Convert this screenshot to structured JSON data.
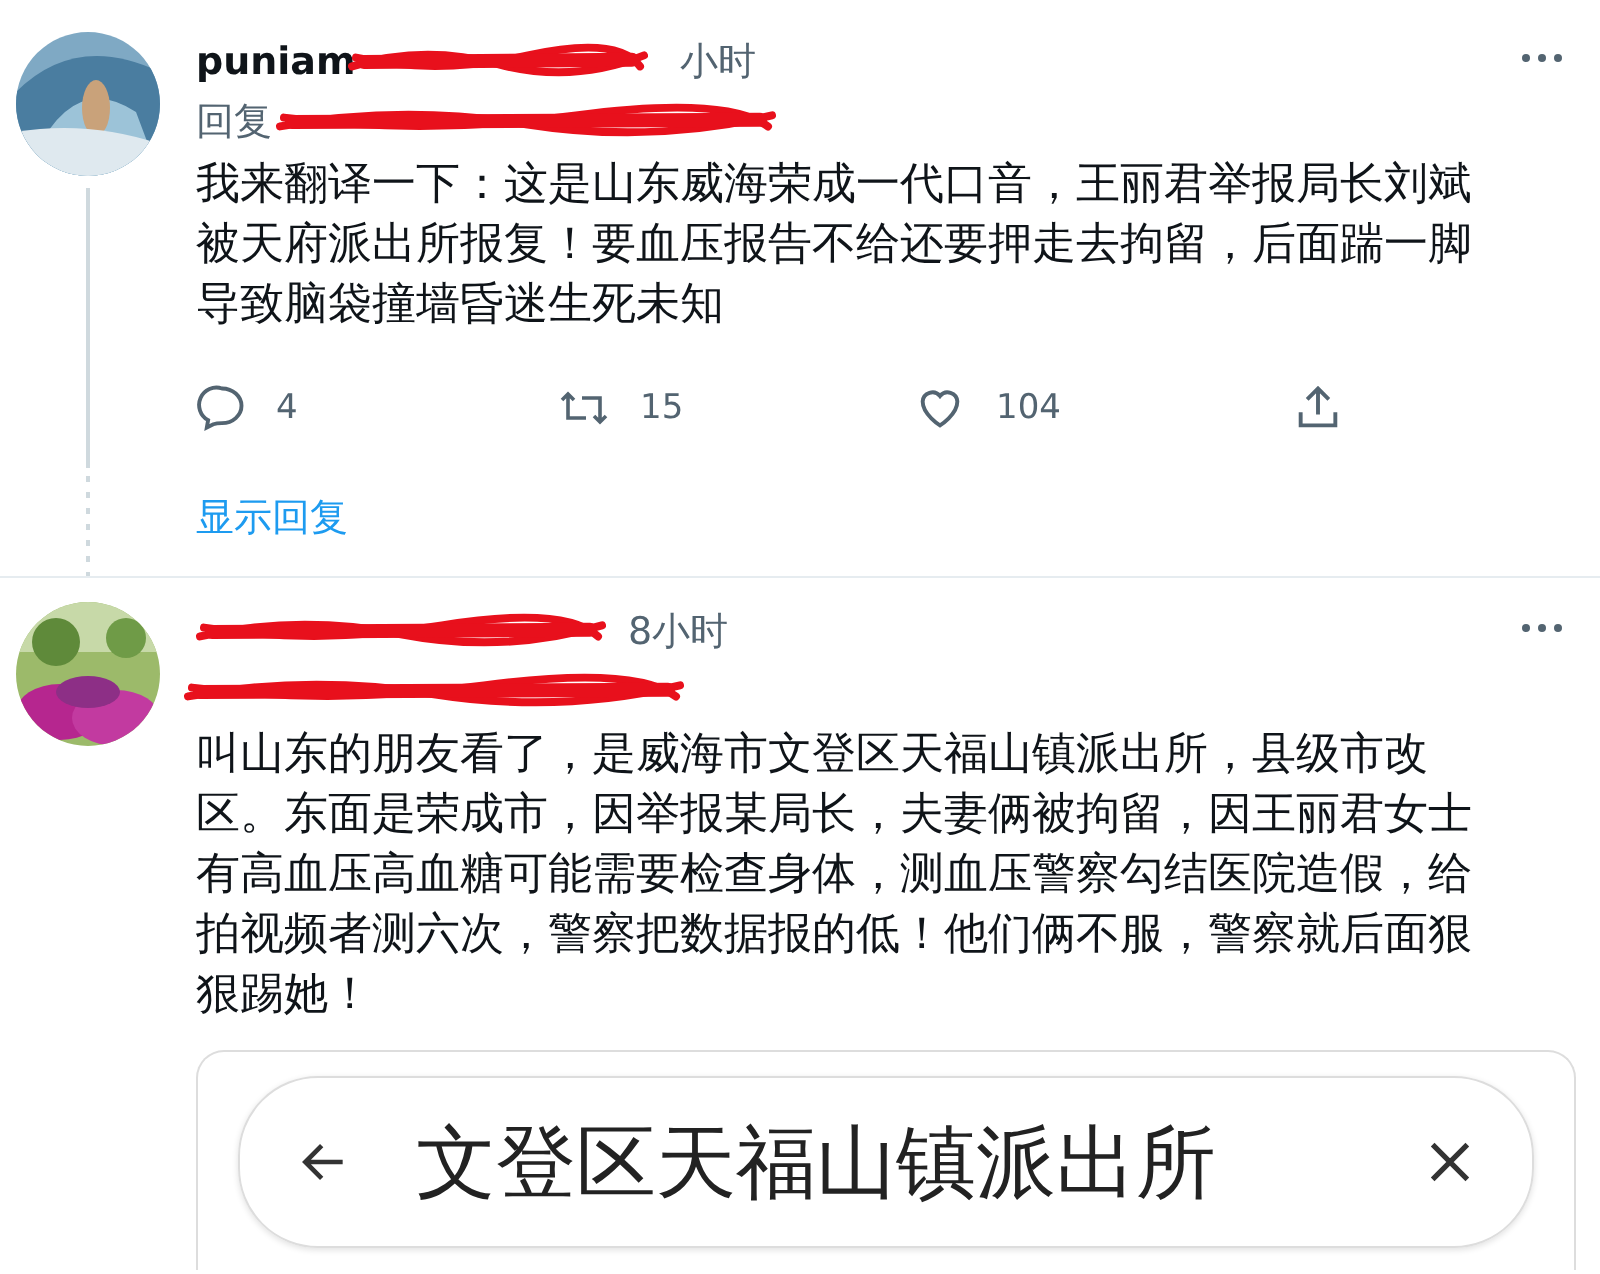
{
  "tweets": [
    {
      "author": "puniam",
      "time": "小时",
      "reply_to": "回复",
      "text": "我来翻译一下：这是山东威海荣成一代口音，王丽君举报局长刘斌被天府派出所报复！要血压报告不给还要押走去拘留，后面踹一脚导致脑袋撞墙昏迷生死未知",
      "thread": true,
      "actions": {
        "replies": "4",
        "retweets": "15",
        "likes": "104"
      },
      "show_replies": "显示回复"
    },
    {
      "time": "8小时",
      "text": "叫山东的朋友看了，是威海市文登区天福山镇派出所，县级市改区。东面是荣成市，因举报某局长，夫妻俩被拘留，因王丽君女士有高血压高血糖可能需要检查身体，测血压警察勾结医院造假，给拍视频者测六次，警察把数据报的低！他们俩不服，警察就后面狠狠踢她！",
      "embed": {
        "search_value": "文登区天福山镇派出所"
      }
    }
  ]
}
